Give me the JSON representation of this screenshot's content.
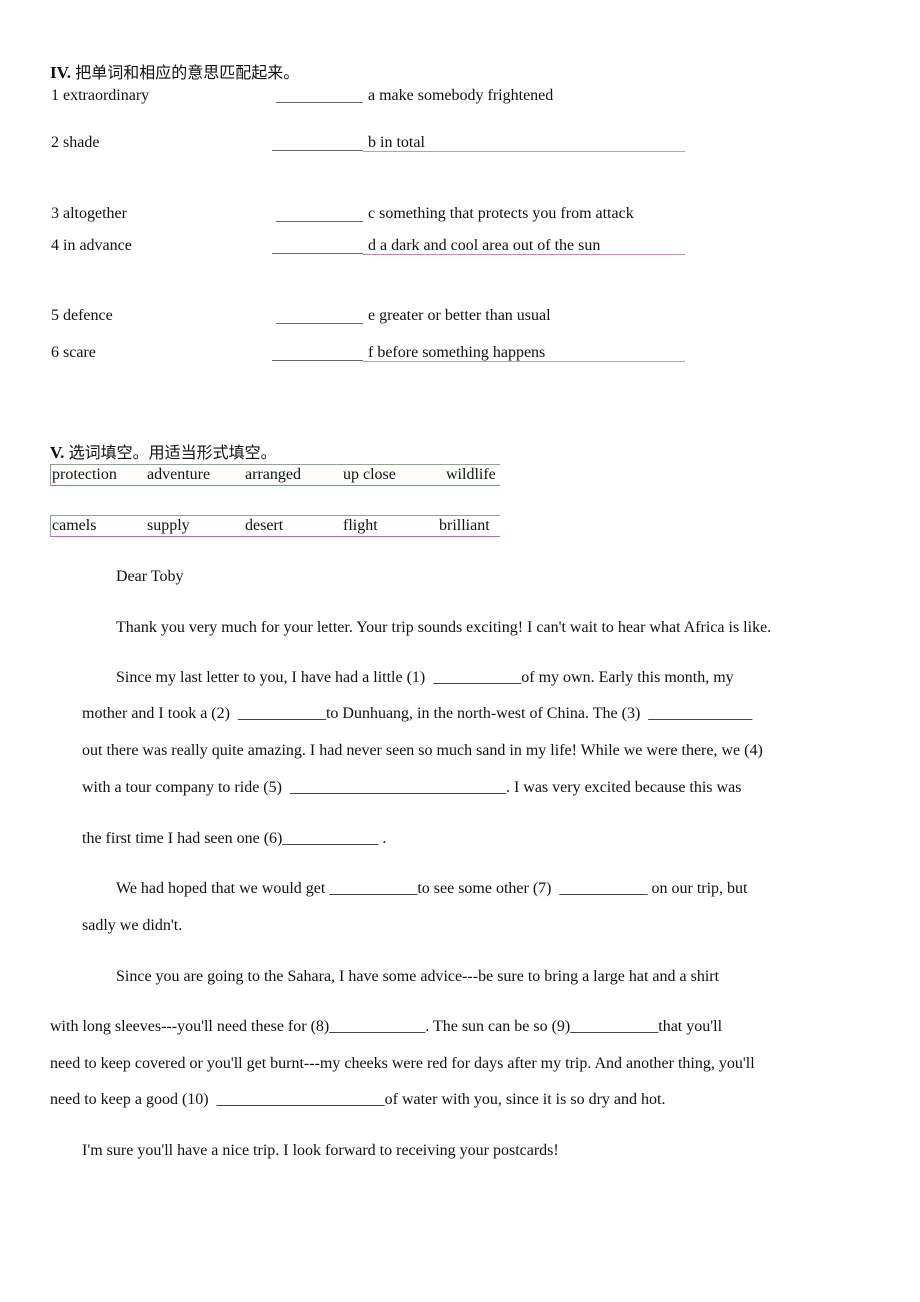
{
  "section4": {
    "title_prefix": "IV.",
    "title_cn": "把单词和相应的意思匹配起来。",
    "items": [
      {
        "word": "1 extraordinary",
        "meaning": "a make somebody frightened"
      },
      {
        "word": "2 shade",
        "meaning": "b in total"
      },
      {
        "word": "3 altogether",
        "meaning": "c something that protects you from attack"
      },
      {
        "word": "4 in advance",
        "meaning": "d a dark and cool area out of the sun"
      },
      {
        "word": "5 defence",
        "meaning": "e greater or better than usual"
      },
      {
        "word": "6 scare",
        "meaning": "f before something happens"
      }
    ]
  },
  "section5": {
    "title_prefix": "V.",
    "title_cn": "选词填空。用适当形式填空。",
    "word_box_rows": [
      [
        "protection",
        "adventure",
        "arranged",
        "up close",
        "wildlife"
      ],
      [
        "camels",
        "supply",
        "desert",
        "flight",
        "brilliant"
      ]
    ],
    "letter_lines": [
      "Dear Toby",
      "Thank you very much for your letter. Your trip sounds exciting! I can't wait to hear what Africa is like.",
      "Since my last letter to you, I have had a little (1)  ___________of my own. Early this month, my",
      "mother and I took a (2)  ___________to Dunhuang, in the north-west of China. The (3)  _____________",
      "out there was really quite amazing. I had never seen so much sand in my life! While we were there, we (4)",
      "with a tour company to ride (5)  ___________________________. I was very excited because this was",
      "the first time I had seen one (6)____________ .",
      "We had hoped that we would get ___________to see some other (7)  ___________ on our trip, but",
      "sadly we didn't.",
      "Since you are going to the Sahara, I have some advice---be sure to bring a large hat and a shirt",
      "with long sleeves---you'll need these for (8)____________. The sun can be so (9)___________that you'll",
      "need to keep covered or you'll get burnt---my cheeks were red for days after my trip. And another thing, you'll",
      "need to keep a good (10)  _____________________of water with you, since it is so dry and hot.",
      "I'm sure you'll have a nice trip. I look forward to receiving your postcards!"
    ]
  }
}
